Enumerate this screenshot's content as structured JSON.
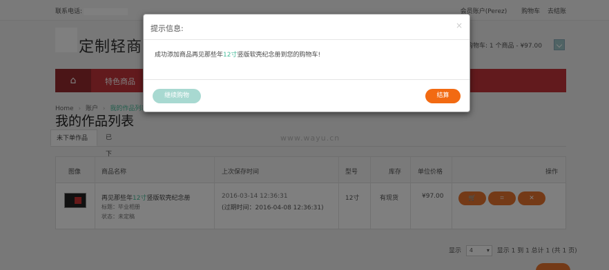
{
  "topbar": {
    "phone_label": "联系电话:",
    "account": "会员账户(Perez)",
    "cart": "购物车",
    "checkout": "去结账"
  },
  "header": {
    "logo_text": "定制轻商",
    "cart_summary": "购物车: 1 个商品 - ¥97.00"
  },
  "nav": {
    "home_icon": "home-icon",
    "item": "特色商品"
  },
  "breadcrumb": {
    "home": "Home",
    "sep": "›",
    "account": "账户",
    "current": "我的作品列表"
  },
  "page": {
    "title": "我的作品列表",
    "tabs": [
      "未下单作品",
      "已下单作品"
    ],
    "watermark": "www.wayu.cn"
  },
  "table": {
    "headers": {
      "image": "图像",
      "name": "商品名称",
      "saved": "上次保存时间",
      "model": "型号",
      "stock": "库存",
      "price": "单位价格",
      "action": "操作"
    },
    "row": {
      "name_prefix": "再见那些年",
      "name_hl": "12寸",
      "name_suffix": "竖版软壳纪念册",
      "tag": "标题：毕业相册",
      "status": "状态：未定稿",
      "saved": "2016-03-14 12:36:31",
      "expiry": "(过期时间：2016-04-08 12:36:31)",
      "model": "12寸",
      "stock": "有现货",
      "price": "¥97.00",
      "actions": [
        "cart-icon",
        "crop-icon",
        "close-icon"
      ]
    }
  },
  "pager": {
    "show": "显示",
    "per_page": "4",
    "summary": "显示 1 到 1 总计 1 (共 1 页)"
  },
  "modal": {
    "title": "提示信息:",
    "close": "×",
    "msg_prefix": "成功添加商品再见那些年",
    "msg_hl": "12寸",
    "msg_suffix": "竖版软壳纪念册到您的购物车!",
    "continue_label": "继续购物",
    "checkout_label": "结算"
  },
  "colors": {
    "nav_red": "#c5353b",
    "accent_orange": "#f26a12",
    "accent_green": "#44bb99"
  }
}
